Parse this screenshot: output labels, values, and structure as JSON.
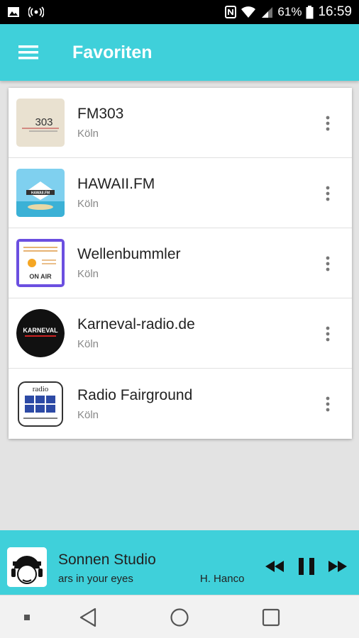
{
  "status_bar": {
    "battery": "61%",
    "time": "16:59"
  },
  "app_bar": {
    "title": "Favoriten"
  },
  "stations": [
    {
      "name": "FM303",
      "city": "Köln",
      "logo_text": "303"
    },
    {
      "name": "HAWAII.FM",
      "city": "Köln",
      "logo_text": "HAWAII.FM"
    },
    {
      "name": "Wellenbummler",
      "city": "Köln",
      "logo_text": "ON AIR"
    },
    {
      "name": "Karneval-radio.de",
      "city": "Köln",
      "logo_text": "KARNEVAL"
    },
    {
      "name": "Radio Fairground",
      "city": "Köln",
      "logo_text": "radio"
    }
  ],
  "player": {
    "station": "Sonnen Studio",
    "track": "ars in your eyes",
    "artist": "H. Hanco"
  },
  "colors": {
    "accent": "#3fd0da",
    "status_bar": "#000000"
  }
}
